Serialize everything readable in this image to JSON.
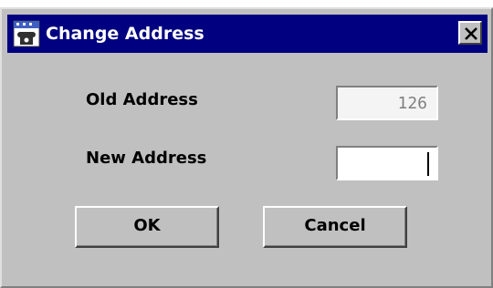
{
  "window": {
    "title": "Change Address",
    "app_icon": "telephone-calendar-icon",
    "close_icon": "close-icon"
  },
  "form": {
    "old_address_label": "Old Address",
    "old_address_value": "126",
    "new_address_label": "New Address",
    "new_address_value": ""
  },
  "buttons": {
    "ok_label": "OK",
    "cancel_label": "Cancel"
  },
  "colors": {
    "titlebar": "#000080",
    "dialog_face": "#c0c0c0"
  }
}
